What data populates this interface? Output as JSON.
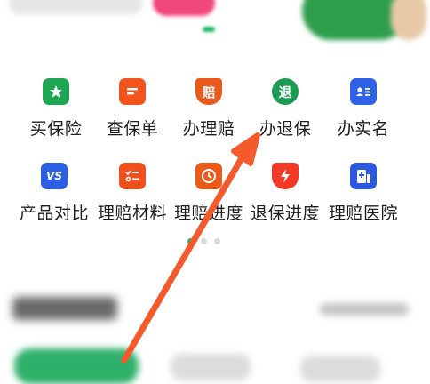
{
  "services": [
    {
      "label": "买保险",
      "icon": "shield-star-icon",
      "color": "#1fa653",
      "glyph": "★"
    },
    {
      "label": "查保单",
      "icon": "document-list-icon",
      "color": "#f2541b",
      "glyph": "≡"
    },
    {
      "label": "办理赔",
      "icon": "claim-badge-icon",
      "color": "#ea5a1c",
      "glyph": "赔"
    },
    {
      "label": "办退保",
      "icon": "surrender-icon",
      "color": "#1b9a52",
      "glyph": "退"
    },
    {
      "label": "办实名",
      "icon": "id-card-icon",
      "color": "#2f62e6",
      "glyph": "≣"
    },
    {
      "label": "产品对比",
      "icon": "versus-icon",
      "color": "#2c5fe3",
      "glyph": "VS"
    },
    {
      "label": "理赔材料",
      "icon": "checklist-icon",
      "color": "#f0511c",
      "glyph": "☰"
    },
    {
      "label": "理赔进度",
      "icon": "clock-icon",
      "color": "#ec5a1a",
      "glyph": "◷"
    },
    {
      "label": "退保进度",
      "icon": "lightning-shield-icon",
      "color": "#f23a26",
      "glyph": "ϟ"
    },
    {
      "label": "理赔医院",
      "icon": "hospital-icon",
      "color": "#2b58de",
      "glyph": "✚"
    }
  ],
  "pager": {
    "pages": 3,
    "active": 0
  },
  "colors": {
    "accent": "#2ab46a",
    "arrow": "#f45a2c"
  }
}
